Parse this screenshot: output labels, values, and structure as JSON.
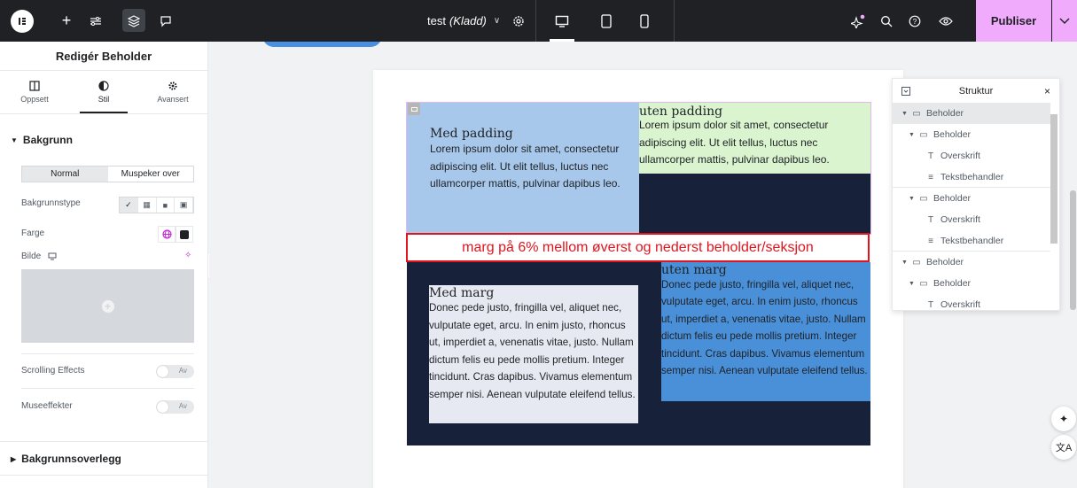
{
  "topbar": {
    "doc_name": "test",
    "doc_state": "(Kladd)",
    "publish_label": "Publiser",
    "icons": [
      "elementor-logo-icon",
      "add-icon",
      "site-settings-icon",
      "structure-icon",
      "notes-icon",
      "settings-icon",
      "desktop-icon",
      "tablet-icon",
      "mobile-icon",
      "ai-sparkle-icon",
      "search-icon",
      "help-icon",
      "preview-icon",
      "chevron-down-icon"
    ]
  },
  "panel": {
    "title": "Redigér Beholder",
    "tabs": [
      "Oppsett",
      "Stil",
      "Avansert"
    ],
    "active_tab": "Stil",
    "section_background": "Bakgrunn",
    "state_toggle": [
      "Normal",
      "Muspeker over"
    ],
    "active_state": "Normal",
    "bg_type_label": "Bakgrunnstype",
    "color_label": "Farge",
    "image_label": "Bilde",
    "scrolling_label": "Scrolling Effects",
    "scrolling_value": "Av",
    "mouse_label": "Museeffekter",
    "mouse_value": "Av",
    "section_overlay": "Bakgrunnsoverlegg"
  },
  "canvas": {
    "top_left_heading": "Med padding",
    "top_left_text": "Lorem ipsum dolor sit amet, consectetur adipiscing elit. Ut elit tellus, luctus nec ullamcorper mattis, pulvinar dapibus leo.",
    "top_right_heading": "uten padding",
    "top_right_text": "Lorem ipsum dolor sit amet, consectetur adipiscing elit. Ut elit tellus, luctus nec ullamcorper mattis, pulvinar dapibus leo.",
    "annotation": "marg på 6% mellom øverst og nederst beholder/seksjon",
    "bottom_left_heading": "Med marg",
    "bottom_left_text": "Donec pede justo, fringilla vel, aliquet nec, vulputate eget, arcu. In enim justo, rhoncus ut, imperdiet a, venenatis vitae, justo. Nullam dictum felis eu pede mollis pretium. Integer tincidunt. Cras dapibus. Vivamus elementum semper nisi. Aenean vulputate eleifend tellus.",
    "bottom_right_heading": "uten marg",
    "bottom_right_text": "Donec pede justo, fringilla vel, aliquet nec, vulputate eget, arcu. In enim justo, rhoncus ut, imperdiet a, venenatis vitae, justo. Nullam dictum felis eu pede mollis pretium. Integer tincidunt. Cras dapibus. Vivamus elementum semper nisi. Aenean vulputate eleifend tellus.",
    "colors": {
      "light_blue": "#a7c8eb",
      "light_green": "#d9f4cf",
      "navy": "#17213a",
      "pale_grey": "#e6e9f1",
      "mid_blue": "#4a90d9",
      "annotation_red": "#e2141d"
    }
  },
  "structure": {
    "title": "Struktur",
    "close": "×",
    "more": "…",
    "items": [
      {
        "label": "Beholder",
        "type": "container"
      },
      {
        "label": "Beholder",
        "type": "container"
      },
      {
        "label": "Overskrift",
        "type": "heading"
      },
      {
        "label": "Tekstbehandler",
        "type": "text"
      },
      {
        "label": "Beholder",
        "type": "container"
      },
      {
        "label": "Overskrift",
        "type": "heading"
      },
      {
        "label": "Tekstbehandler",
        "type": "text"
      },
      {
        "label": "Beholder",
        "type": "container"
      },
      {
        "label": "Beholder",
        "type": "container"
      },
      {
        "label": "Overskrift",
        "type": "heading"
      }
    ]
  }
}
